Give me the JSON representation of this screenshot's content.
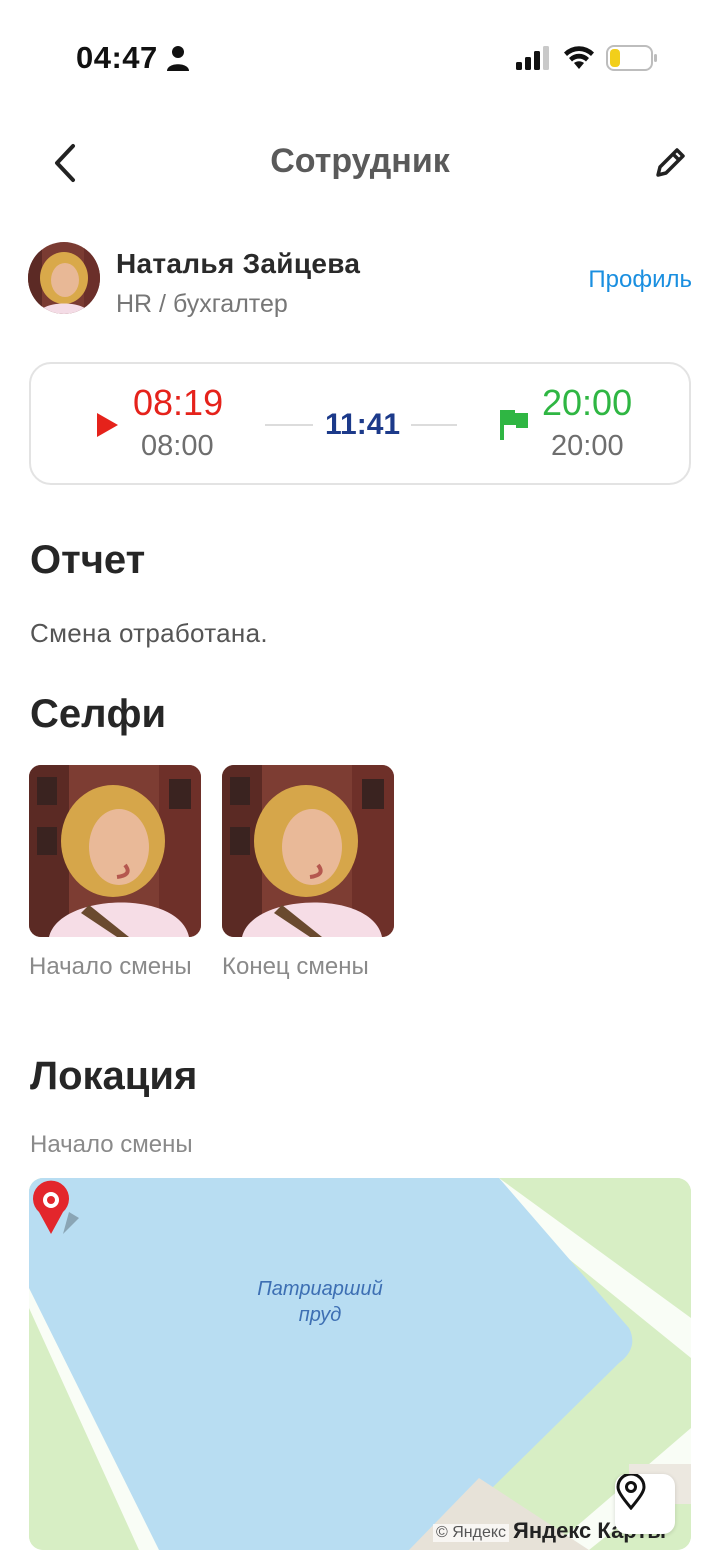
{
  "status_bar": {
    "time": "04:47"
  },
  "nav": {
    "title": "Сотрудник"
  },
  "employee": {
    "name": "Наталья Зайцева",
    "role": "HR / бухгалтер",
    "profile_link": "Профиль"
  },
  "shift": {
    "start_actual": "08:19",
    "start_planned": "08:00",
    "duration": "11:41",
    "end_actual": "20:00",
    "end_planned": "20:00",
    "colors": {
      "start": "#e5221b",
      "end": "#2fb643",
      "duration": "#1c3a8a"
    }
  },
  "report": {
    "title": "Отчет",
    "text": "Смена отработана."
  },
  "selfie": {
    "title": "Селфи",
    "items": [
      {
        "label": "Начало смены"
      },
      {
        "label": "Конец смены"
      }
    ]
  },
  "location": {
    "title": "Локация",
    "subtitle": "Начало смены",
    "map": {
      "place_label": "Патриарший пруд",
      "copyright": "© Яндекс",
      "brand": "Яндекс Карты"
    }
  }
}
